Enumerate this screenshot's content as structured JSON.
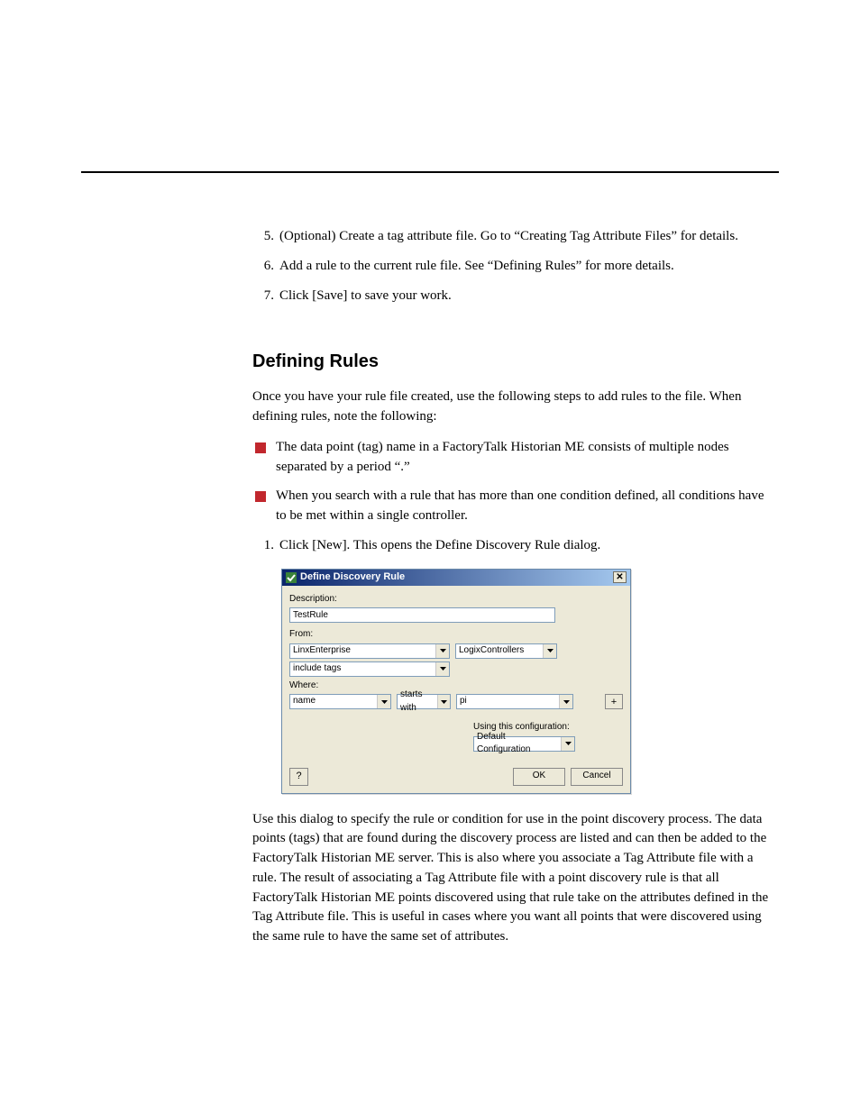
{
  "steps_top": [
    {
      "num": "5.",
      "text": "(Optional) Create a tag attribute file. Go to “Creating Tag Attribute Files” for details."
    },
    {
      "num": "6.",
      "text": "Add a rule to the current rule file. See “Defining Rules” for more details."
    },
    {
      "num": "7.",
      "text": "Click [Save] to save your work."
    }
  ],
  "section_heading": "Defining Rules",
  "intro_para": "Once you have your rule file created, use the following steps to add rules to the file. When defining rules, note the following:",
  "bullets": [
    "The data point (tag) name in a FactoryTalk Historian ME consists of multiple nodes separated by a period “.”",
    "When you search with a rule that has more than one condition defined, all conditions have to be met within a single controller."
  ],
  "step_after_bullets": {
    "num": "1.",
    "text": "Click [New]. This opens the Define Discovery Rule dialog."
  },
  "dialog": {
    "title": "Define Discovery Rule",
    "close_glyph": "✕",
    "labels": {
      "description": "Description:",
      "from": "From:",
      "where": "Where:",
      "using_config": "Using this configuration:"
    },
    "fields": {
      "description_value": "TestRule",
      "from_source": "LinxEnterprise",
      "from_target": "LogixControllers",
      "tag_scope": "include tags",
      "where_field": "name",
      "where_op": "starts with",
      "where_value": "pi",
      "config": "Default Configuration"
    },
    "buttons": {
      "plus": "+",
      "help": "?",
      "ok": "OK",
      "cancel": "Cancel"
    }
  },
  "after_para": "Use this dialog to specify the rule or condition for use in the point discovery process. The data points (tags) that are found during the discovery process are listed and can then be added to the FactoryTalk Historian ME server. This is also where you associate a Tag Attribute file with a rule. The result of associating a Tag Attribute file with a point discovery rule is that all FactoryTalk Historian ME points discovered using that rule take on the attributes defined in the Tag Attribute file. This is useful in cases where you want all points that were discovered using the same rule to have the same set of attributes."
}
